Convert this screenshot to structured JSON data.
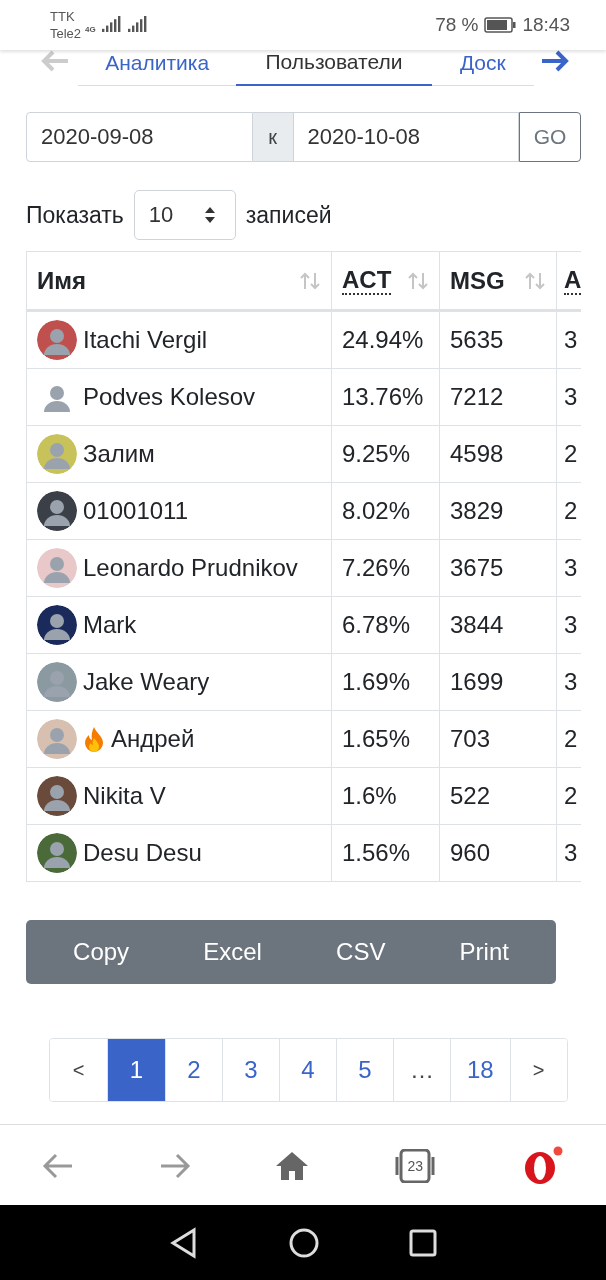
{
  "status_bar": {
    "carrier_1": "TTK",
    "carrier_2": "Tele2",
    "network": "4G",
    "battery_text": "78 %",
    "time": "18:43"
  },
  "tabs": [
    {
      "label": "Аналитика",
      "selected": false
    },
    {
      "label": "Пользователи",
      "selected": true
    },
    {
      "label": "Доск",
      "selected": false
    }
  ],
  "date_range": {
    "from": "2020-09-08",
    "separator": "к",
    "to": "2020-10-08",
    "button": "GO"
  },
  "length_menu": {
    "prefix": "Показать",
    "value": "10",
    "suffix": "записей"
  },
  "table": {
    "columns": [
      {
        "label": "Имя",
        "sortable": true,
        "underlined": false
      },
      {
        "label": "ACT",
        "sortable": true,
        "underlined": true
      },
      {
        "label": "MSG",
        "sortable": true,
        "underlined": false
      },
      {
        "label": "A",
        "sortable": false,
        "underlined": true
      }
    ],
    "rows": [
      {
        "name": "Itachi Vergil",
        "act": "24.94%",
        "msg": "5635",
        "column_4": "3"
      },
      {
        "name": "Podves Kolesov",
        "act": "13.76%",
        "msg": "7212",
        "column_4": "3"
      },
      {
        "name": "Залим",
        "act": "9.25%",
        "msg": "4598",
        "column_4": "2"
      },
      {
        "name": "01001011",
        "act": "8.02%",
        "msg": "3829",
        "column_4": "2"
      },
      {
        "name": "Leonardo Prudnikov",
        "act": "7.26%",
        "msg": "3675",
        "column_4": "3"
      },
      {
        "name": "Mark",
        "act": "6.78%",
        "msg": "3844",
        "column_4": "3"
      },
      {
        "name": "Jake Weary",
        "act": "1.69%",
        "msg": "1699",
        "column_4": "3"
      },
      {
        "name": "Андрей",
        "act": "1.65%",
        "msg": "703",
        "column_4": "2",
        "kind": "flame"
      },
      {
        "name": "Nikita V",
        "act": "1.6%",
        "msg": "522",
        "column_4": "2"
      },
      {
        "name": "Desu Desu",
        "act": "1.56%",
        "msg": "960",
        "column_4": "3"
      }
    ]
  },
  "export_buttons": [
    "Copy",
    "Excel",
    "CSV",
    "Print"
  ],
  "pagination": [
    {
      "label": "<",
      "selected": false,
      "kind": "arrow"
    },
    {
      "label": "1",
      "selected": true,
      "kind": "page"
    },
    {
      "label": "2",
      "selected": false,
      "kind": "page"
    },
    {
      "label": "3",
      "selected": false,
      "kind": "page"
    },
    {
      "label": "4",
      "selected": false,
      "kind": "page"
    },
    {
      "label": "5",
      "selected": false,
      "kind": "page"
    },
    {
      "label": "…",
      "selected": false,
      "kind": "ellipsis"
    },
    {
      "label": "18",
      "selected": false,
      "kind": "page"
    },
    {
      "label": ">",
      "selected": false,
      "kind": "arrow"
    }
  ],
  "browser_bar": {
    "tabs_count": "23",
    "notification": true
  }
}
